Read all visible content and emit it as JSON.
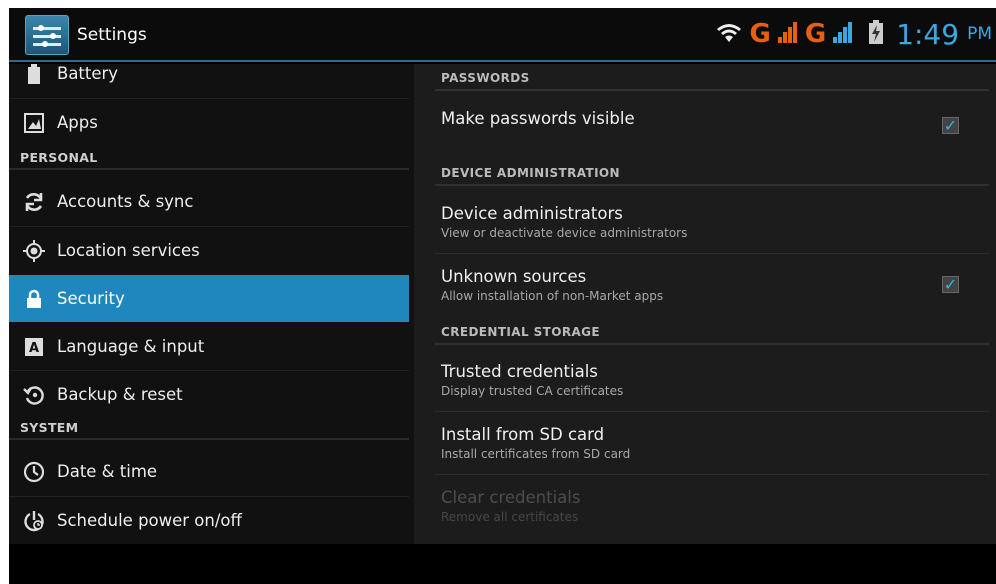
{
  "action_bar": {
    "title": "Settings"
  },
  "status_bar": {
    "network1": "G",
    "network2": "G",
    "time": "1:49",
    "ampm": "PM"
  },
  "left": {
    "items_top": [
      {
        "label": "Battery",
        "icon": "battery-icon"
      },
      {
        "label": "Apps",
        "icon": "apps-icon"
      }
    ],
    "section_personal": "PERSONAL",
    "personal": [
      {
        "label": "Accounts & sync",
        "icon": "sync-icon"
      },
      {
        "label": "Location services",
        "icon": "location-icon"
      },
      {
        "label": "Security",
        "icon": "lock-icon",
        "selected": true
      },
      {
        "label": "Language & input",
        "icon": "keyboard-icon"
      },
      {
        "label": "Backup & reset",
        "icon": "backup-icon"
      }
    ],
    "section_system": "SYSTEM",
    "system": [
      {
        "label": "Date & time",
        "icon": "clock-icon"
      },
      {
        "label": "Schedule power on/off",
        "icon": "power-schedule-icon"
      }
    ]
  },
  "right": {
    "passwords": {
      "header": "PASSWORDS",
      "make_visible": {
        "title": "Make passwords visible",
        "checked": true
      }
    },
    "device_admin": {
      "header": "DEVICE ADMINISTRATION",
      "administrators": {
        "title": "Device administrators",
        "summary": "View or deactivate device administrators"
      },
      "unknown_sources": {
        "title": "Unknown sources",
        "summary": "Allow installation of non-Market apps",
        "checked": true
      }
    },
    "credential_storage": {
      "header": "CREDENTIAL STORAGE",
      "trusted": {
        "title": "Trusted credentials",
        "summary": "Display trusted CA certificates"
      },
      "install": {
        "title": "Install from SD card",
        "summary": "Install certificates from SD card"
      },
      "clear": {
        "title": "Clear credentials",
        "summary": "Remove all certificates",
        "enabled": false
      }
    }
  },
  "colors": {
    "accent": "#1f87bd",
    "clock": "#3ba7e0",
    "network": "#e8600f"
  }
}
